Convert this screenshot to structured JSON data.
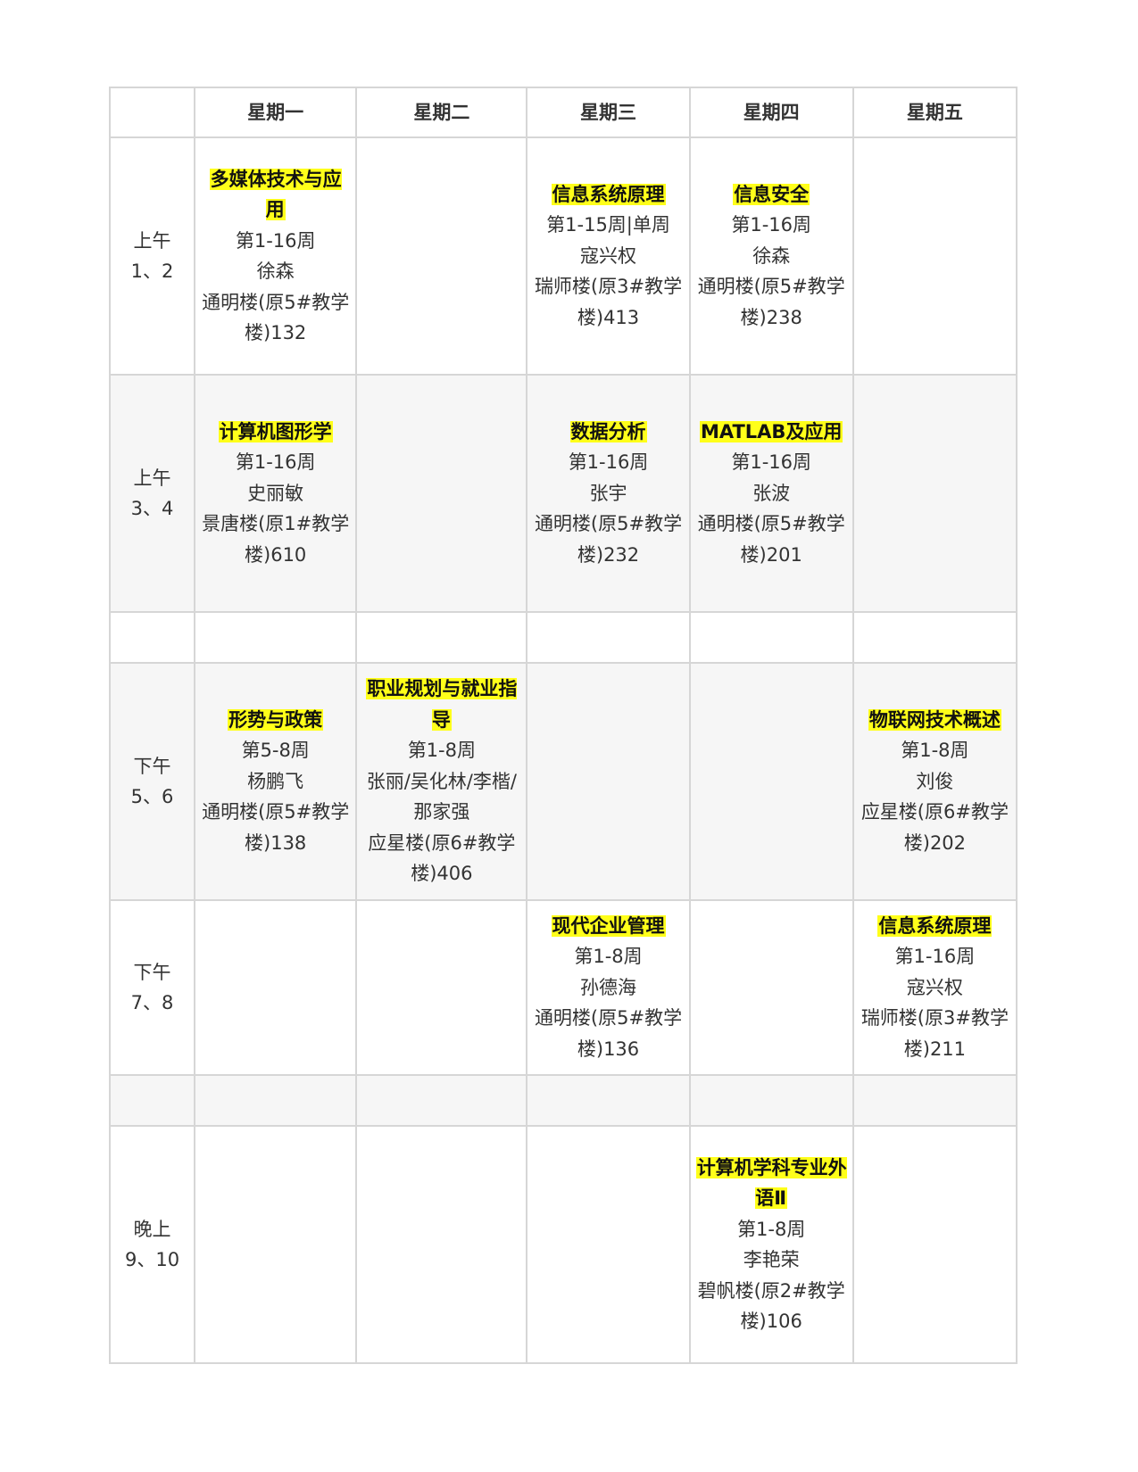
{
  "headers": [
    "",
    "星期一",
    "星期二",
    "星期三",
    "星期四",
    "星期五"
  ],
  "rows": [
    {
      "label": "上午 1、2",
      "cells": [
        {
          "name": "多媒体技术与应用",
          "weeks": "第1-16周",
          "teacher": "徐森",
          "room": "通明楼(原5#教学楼)132"
        },
        null,
        {
          "name": "信息系统原理",
          "weeks": "第1-15周|单周",
          "teacher": "寇兴权",
          "room": "瑞师楼(原3#教学楼)413"
        },
        {
          "name": "信息安全",
          "weeks": "第1-16周",
          "teacher": "徐森",
          "room": "通明楼(原5#教学楼)238"
        },
        null
      ]
    },
    {
      "label": "上午 3、4",
      "cells": [
        {
          "name": "计算机图形学",
          "weeks": "第1-16周",
          "teacher": "史丽敏",
          "room": "景唐楼(原1#教学楼)610"
        },
        null,
        {
          "name": "数据分析",
          "weeks": "第1-16周",
          "teacher": "张宇",
          "room": "通明楼(原5#教学楼)232"
        },
        {
          "name": "MATLAB及应用",
          "weeks": "第1-16周",
          "teacher": "张波",
          "room": "通明楼(原5#教学楼)201"
        },
        null
      ]
    },
    {
      "label": "",
      "cells": [
        null,
        null,
        null,
        null,
        null
      ]
    },
    {
      "label": "下午 5、6",
      "cells": [
        {
          "name": "形势与政策",
          "weeks": "第5-8周",
          "teacher": "杨鹏飞",
          "room": "通明楼(原5#教学楼)138"
        },
        {
          "name": "职业规划与就业指导",
          "weeks": "第1-8周",
          "teacher": "张丽/吴化林/李楷/那家强",
          "room": "应星楼(原6#教学楼)406"
        },
        null,
        null,
        {
          "name": "物联网技术概述",
          "weeks": "第1-8周",
          "teacher": "刘俊",
          "room": "应星楼(原6#教学楼)202"
        }
      ]
    },
    {
      "label": "下午 7、8",
      "cells": [
        null,
        null,
        {
          "name": "现代企业管理",
          "weeks": "第1-8周",
          "teacher": "孙德海",
          "room": "通明楼(原5#教学楼)136"
        },
        null,
        {
          "name": "信息系统原理",
          "weeks": "第1-16周",
          "teacher": "寇兴权",
          "room": "瑞师楼(原3#教学楼)211"
        }
      ]
    },
    {
      "label": "",
      "cells": [
        null,
        null,
        null,
        null,
        null
      ]
    },
    {
      "label": "晚上 9、10",
      "cells": [
        null,
        null,
        null,
        {
          "name": "计算机学科专业外语Ⅱ",
          "weeks": "第1-8周",
          "teacher": "李艳荣",
          "room": "碧帆楼(原2#教学楼)106"
        },
        null
      ]
    }
  ]
}
